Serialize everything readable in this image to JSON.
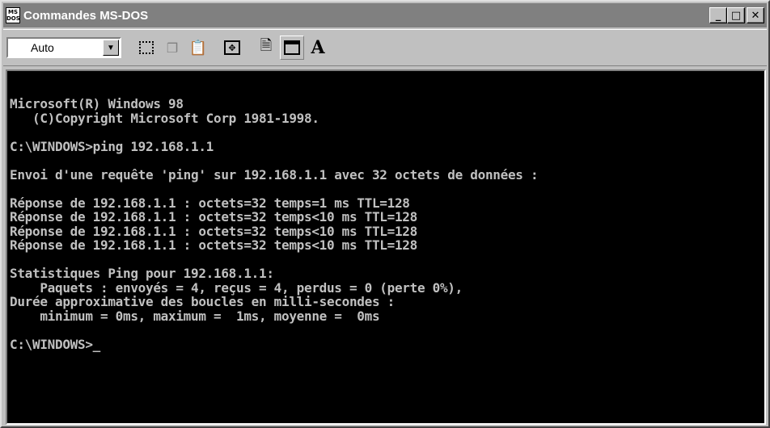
{
  "window": {
    "title": "Commandes MS-DOS",
    "icon_label": "MS\nDOS",
    "controls": {
      "minimize": "_",
      "maximize": "□",
      "close": "✕"
    }
  },
  "toolbar": {
    "font_size_value": "Auto",
    "buttons": [
      {
        "name": "mark-icon"
      },
      {
        "name": "copy-icon"
      },
      {
        "name": "paste-icon"
      },
      {
        "name": "fullscreen-icon"
      },
      {
        "name": "properties-icon"
      },
      {
        "name": "background-icon"
      },
      {
        "name": "font-icon",
        "label": "A"
      }
    ]
  },
  "console": {
    "lines": [
      "Microsoft(R) Windows 98",
      "   (C)Copyright Microsoft Corp 1981-1998.",
      "",
      "C:\\WINDOWS>ping 192.168.1.1",
      "",
      "Envoi d'une requête 'ping' sur 192.168.1.1 avec 32 octets de données :",
      "",
      "Réponse de 192.168.1.1 : octets=32 temps=1 ms TTL=128",
      "Réponse de 192.168.1.1 : octets=32 temps<10 ms TTL=128",
      "Réponse de 192.168.1.1 : octets=32 temps<10 ms TTL=128",
      "Réponse de 192.168.1.1 : octets=32 temps<10 ms TTL=128",
      "",
      "Statistiques Ping pour 192.168.1.1:",
      "    Paquets : envoyés = 4, reçus = 4, perdus = 0 (perte 0%),",
      "Durée approximative des boucles en milli-secondes :",
      "    minimum = 0ms, maximum =  1ms, moyenne =  0ms",
      "",
      "C:\\WINDOWS>_"
    ]
  }
}
